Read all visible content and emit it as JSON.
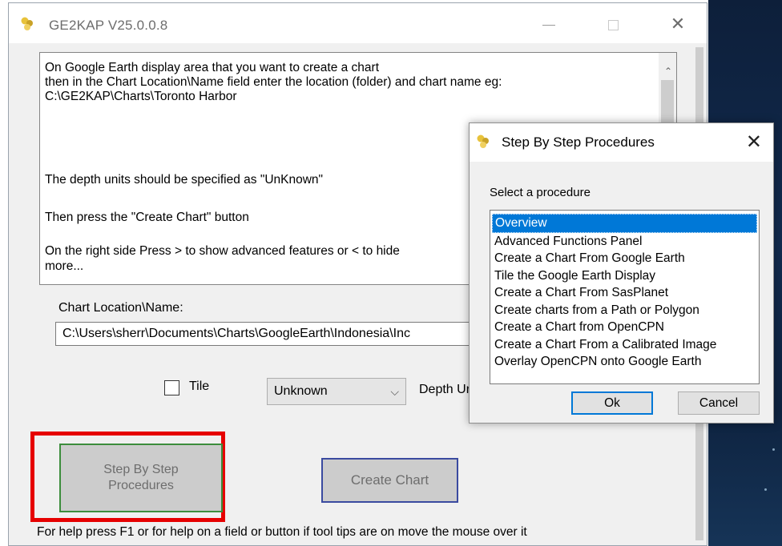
{
  "window": {
    "title": "GE2KAP V25.0.0.8",
    "icon": "ge2kap-app-icon",
    "controls": {
      "minimize": "minimize-icon",
      "maximize": "maximize-icon",
      "close": "✕"
    }
  },
  "instructions": {
    "line1": "On Google Earth display area that you want to create a chart",
    "line2": "then in the Chart Location\\Name field enter the location (folder) and chart name eg:",
    "line3": "C:\\GE2KAP\\Charts\\Toronto Harbor",
    "line4": "The depth units should be specified as \"UnKnown\"",
    "line5": "Then press the \"Create Chart\" button",
    "line6": "On the right side Press > to show advanced features or < to hide",
    "line7": "more...",
    "scroll_up": "⌃"
  },
  "chart_location": {
    "label": "Chart Location\\Name:",
    "value": "C:\\Users\\sherr\\Documents\\Charts\\GoogleEarth\\Indonesia\\Inc"
  },
  "tile": {
    "label": "Tile",
    "checked": false
  },
  "depth": {
    "selected": "Unknown",
    "arrow": "⌵",
    "label": "Depth Ur"
  },
  "buttons": {
    "step_by_step_line1": "Step By Step",
    "step_by_step_line2": "Procedures",
    "create_chart": "Create Chart"
  },
  "help_text": "For help press F1 or for help on a field or button if tool tips are on move the mouse over it",
  "highlight_color": "#e60000",
  "dialog": {
    "title": "Step By Step Procedures",
    "close": "✕",
    "select_label": "Select a procedure",
    "procedures": [
      "Overview",
      "Advanced Functions Panel",
      "Create a Chart From Google Earth",
      "Tile the Google Earth Display",
      "Create a Chart From SasPlanet",
      "Create charts from a Path or Polygon",
      "Create a Chart from OpenCPN",
      "Create a Chart From a Calibrated Image",
      "Overlay OpenCPN onto Google Earth"
    ],
    "selected_index": 0,
    "ok": "Ok",
    "cancel": "Cancel"
  }
}
